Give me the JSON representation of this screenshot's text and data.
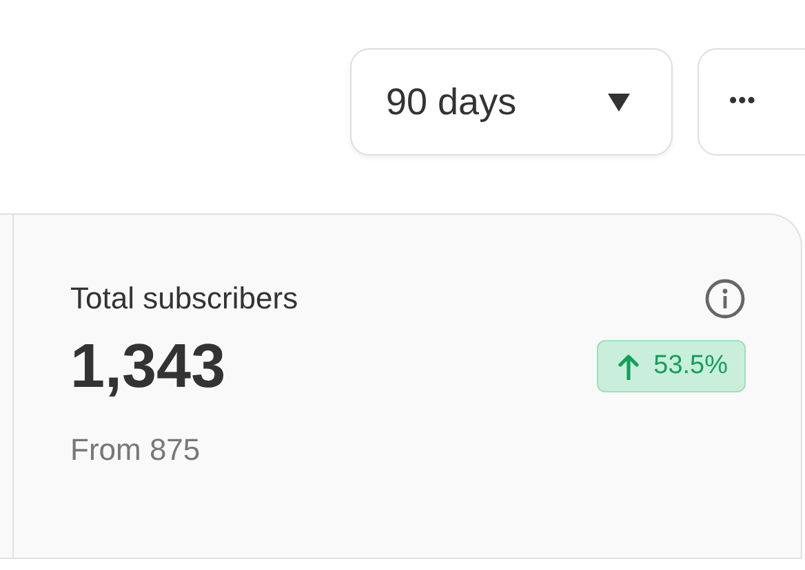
{
  "toolbar": {
    "range_select": {
      "value": "90 days"
    },
    "more_button": {
      "label": "•••"
    }
  },
  "stat_card": {
    "title": "Total subscribers",
    "value": "1,343",
    "change": {
      "rising": true,
      "label": "53.5%"
    },
    "previous": "From 875"
  }
}
